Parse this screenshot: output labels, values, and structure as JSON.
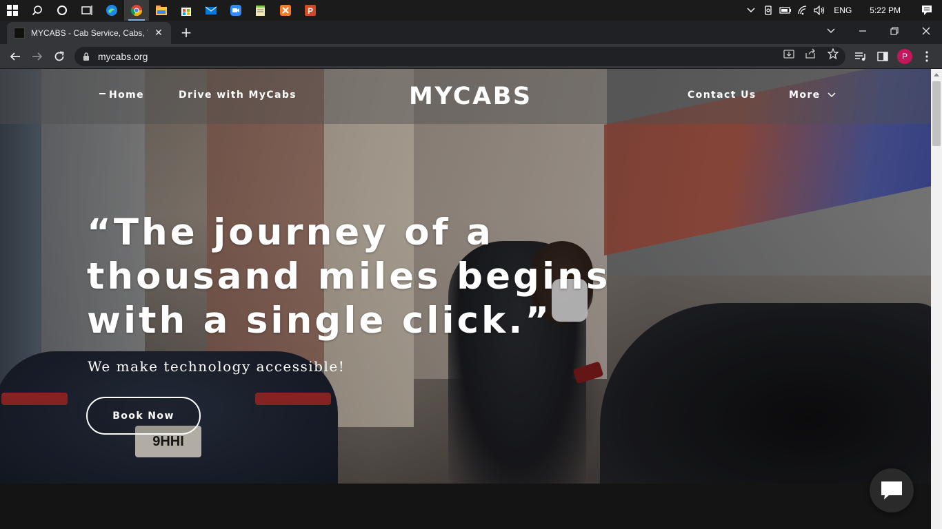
{
  "taskbar": {
    "icons": [
      "windows-start-icon",
      "search-icon",
      "cortana-icon",
      "task-view-icon",
      "edge-icon",
      "chrome-icon",
      "file-explorer-icon",
      "store-icon",
      "mail-icon",
      "zoom-icon",
      "notepad-icon",
      "xampp-icon",
      "powerpoint-icon"
    ],
    "lang": "ENG",
    "time": "5:22 PM"
  },
  "browser": {
    "tab_title": "MYCABS - Cab Service, Cabs, Taxi",
    "tab_close": "✕",
    "new_tab": "+",
    "url": "mycabs.org",
    "profile_initial": "P"
  },
  "site": {
    "nav": {
      "home": "Home",
      "drive": "Drive with MyCabs",
      "brand": "MYCABS",
      "contact": "Contact Us",
      "more": "More"
    },
    "hero": {
      "title": "“The journey of a thousand miles begins with a single click.”",
      "subtitle": "We make technology accessible!",
      "cta": "Book Now"
    },
    "plate": "9HHI"
  },
  "colors": {
    "taskbar_bg": "#1b1b1b",
    "tabstrip_bg": "#202124",
    "toolbar_bg": "#35363a",
    "profile": "#c2185b",
    "page_bg": "#141414"
  }
}
